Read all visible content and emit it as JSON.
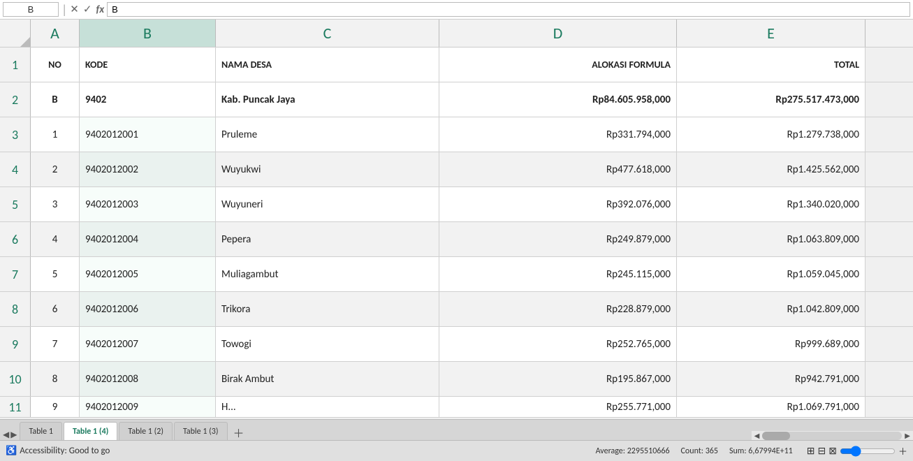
{
  "formulaBar": {
    "nameBox": "B",
    "icons": [
      "✕",
      "✓",
      "fx"
    ],
    "value": "B"
  },
  "columns": {
    "headers": [
      "A",
      "B",
      "C",
      "D",
      "E"
    ]
  },
  "rows": [
    {
      "rowNum": "1",
      "type": "header",
      "cells": {
        "a": "NO",
        "b": "KODE",
        "c": "NAMA DESA",
        "d": "ALOKASI FORMULA",
        "e": "TOTAL"
      }
    },
    {
      "rowNum": "2",
      "type": "kab",
      "cells": {
        "a": "B",
        "b": "9402",
        "c": "Kab.  Puncak  Jaya",
        "d": "Rp84.605.958,000",
        "e": "Rp275.517.473,000"
      }
    },
    {
      "rowNum": "3",
      "type": "data",
      "cells": {
        "a": "1",
        "b": "9402012001",
        "c": "Pruleme",
        "d": "Rp331.794,000",
        "e": "Rp1.279.738,000"
      }
    },
    {
      "rowNum": "4",
      "type": "data-alt",
      "cells": {
        "a": "2",
        "b": "9402012002",
        "c": "Wuyukwi",
        "d": "Rp477.618,000",
        "e": "Rp1.425.562,000"
      }
    },
    {
      "rowNum": "5",
      "type": "data",
      "cells": {
        "a": "3",
        "b": "9402012003",
        "c": "Wuyuneri",
        "d": "Rp392.076,000",
        "e": "Rp1.340.020,000"
      }
    },
    {
      "rowNum": "6",
      "type": "data-alt",
      "cells": {
        "a": "4",
        "b": "9402012004",
        "c": "Pepera",
        "d": "Rp249.879,000",
        "e": "Rp1.063.809,000"
      }
    },
    {
      "rowNum": "7",
      "type": "data",
      "cells": {
        "a": "5",
        "b": "9402012005",
        "c": "Muliagambut",
        "d": "Rp245.115,000",
        "e": "Rp1.059.045,000"
      }
    },
    {
      "rowNum": "8",
      "type": "data-alt",
      "cells": {
        "a": "6",
        "b": "9402012006",
        "c": "Trikora",
        "d": "Rp228.879,000",
        "e": "Rp1.042.809,000"
      }
    },
    {
      "rowNum": "9",
      "type": "data",
      "cells": {
        "a": "7",
        "b": "9402012007",
        "c": "Towogi",
        "d": "Rp252.765,000",
        "e": "Rp999.689,000"
      }
    },
    {
      "rowNum": "10",
      "type": "data-alt",
      "cells": {
        "a": "8",
        "b": "9402012008",
        "c": "Birak  Ambut",
        "d": "Rp195.867,000",
        "e": "Rp942.791,000"
      }
    },
    {
      "rowNum": "11",
      "type": "data",
      "cells": {
        "a": "9",
        "b": "9402012009",
        "c": "H...",
        "d": "Rp255.771,000",
        "e": "Rp1.069.791,000"
      }
    }
  ],
  "tabs": [
    {
      "label": "Table 1",
      "active": false
    },
    {
      "label": "Table 1 (4)",
      "active": true
    },
    {
      "label": "Table 1 (2)",
      "active": false
    },
    {
      "label": "Table 1 (3)",
      "active": false
    }
  ],
  "statusBar": {
    "accessibility": "Accessibility: Good to go",
    "average": "Average: 2295510666",
    "count": "Count: 365",
    "sum": "Sum: 6,67994E+11"
  }
}
